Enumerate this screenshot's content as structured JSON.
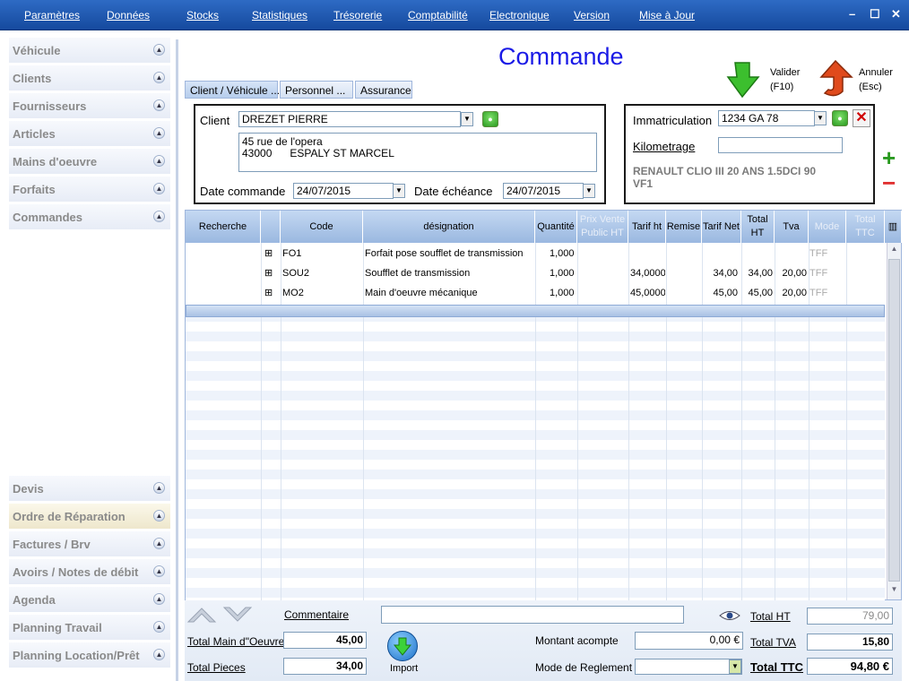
{
  "menu": [
    "Paramètres",
    "Données",
    "Stocks",
    "Statistiques",
    "Trésorerie",
    "Comptabilité",
    "Electronique",
    "Version",
    "Mise à Jour"
  ],
  "window_controls": [
    "–",
    "☐",
    "✕"
  ],
  "sidebar_top": [
    "Véhicule",
    "Clients",
    "Fournisseurs",
    "Articles",
    "Mains d'oeuvre",
    "Forfaits",
    "Commandes"
  ],
  "sidebar_bottom": [
    "Devis",
    "Ordre de Réparation",
    "Factures / Brv",
    "Avoirs / Notes de débit",
    "Agenda",
    "Planning Travail",
    "Planning Location/Prêt"
  ],
  "title": "Commande",
  "actions": {
    "validate_label": "Valider",
    "validate_key": "(F10)",
    "cancel_label": "Annuler",
    "cancel_key": "(Esc)"
  },
  "tabs": [
    "Client / Véhicule ...",
    "Personnel  ...",
    "Assurance"
  ],
  "client": {
    "label": "Client",
    "name": "DREZET PIERRE",
    "address1": "45 rue de l'opera",
    "address2": "43000      ESPALY ST MARCEL",
    "date_commande_label": "Date commande",
    "date_commande": "24/07/2015",
    "date_echeance_label": "Date échéance",
    "date_echeance": "24/07/2015"
  },
  "vehicle": {
    "immat_label": "Immatriculation",
    "immat": "1234 GA 78",
    "km_label": "Kilometrage",
    "km": "",
    "model_line1": "RENAULT CLIO III 20 ANS 1.5DCI 90",
    "model_line2": "VF1"
  },
  "side_buttons": {
    "add": "+",
    "remove": "−"
  },
  "grid": {
    "headers": [
      "Recherche",
      "",
      "Code",
      "désignation",
      "Quantité",
      "Prix Vente Public HT",
      "Tarif ht",
      "Remise",
      "Tarif Net",
      "Total HT",
      "Tva",
      "Mode",
      "Total TTC"
    ],
    "rows": [
      {
        "expand": "⊞",
        "code": "FO1",
        "designation": "Forfait pose soufflet de transmission",
        "qty": "1,000",
        "prix": "",
        "tarif": "",
        "remise": "",
        "net": "",
        "total": "",
        "tva": "",
        "mode": "TFF",
        "ttc": ""
      },
      {
        "expand": "⊞",
        "code": "SOU2",
        "designation": "Soufflet de transmission",
        "qty": "1,000",
        "prix": "",
        "tarif": "34,0000",
        "remise": "",
        "net": "34,00",
        "total": "34,00",
        "tva": "20,00",
        "mode": "TFF",
        "ttc": ""
      },
      {
        "expand": "⊞",
        "code": "MO2",
        "designation": "Main d'oeuvre mécanique",
        "qty": "1,000",
        "prix": "",
        "tarif": "45,0000",
        "remise": "",
        "net": "45,00",
        "total": "45,00",
        "tva": "20,00",
        "mode": "TFF",
        "ttc": ""
      }
    ]
  },
  "footer": {
    "commentaire_label": "Commentaire",
    "commentaire": "",
    "total_mo_label": "Total Main d\"Oeuvre",
    "total_mo": "45,00",
    "total_pieces_label": "Total Pieces",
    "total_pieces": "34,00",
    "import_label": "Import",
    "acompte_label": "Montant acompte",
    "acompte": "0,00 €",
    "reglement_label": "Mode de Reglement :",
    "reglement": "",
    "total_ht_label": "Total HT",
    "total_ht": "79,00",
    "total_tva_label": "Total TVA",
    "total_tva": "15,80",
    "total_ttc_label": "Total TTC",
    "total_ttc": "94,80 €"
  },
  "colors": {
    "menubar": "#1f5bb5",
    "title": "#1a1ae6",
    "header": "#a9c4e8"
  }
}
